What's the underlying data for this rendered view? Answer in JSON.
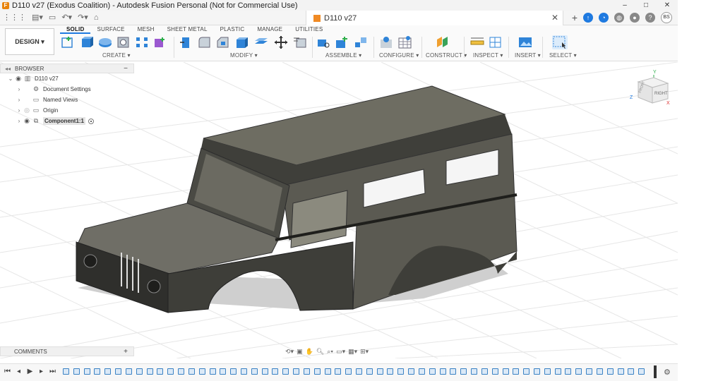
{
  "window": {
    "title": "D110 v27 (Exodus Coalition) - Autodesk Fusion Personal (Not for Commercial Use)",
    "controls": [
      "–",
      "□",
      "✕"
    ]
  },
  "tabbar": {
    "document_tab": "D110 v27",
    "user_initials": "BS"
  },
  "ribbon": {
    "workspace": "DESIGN",
    "tabs": [
      "SOLID",
      "SURFACE",
      "MESH",
      "SHEET METAL",
      "PLASTIC",
      "MANAGE",
      "UTILITIES"
    ],
    "active_tab": "SOLID",
    "groups": {
      "create": "CREATE",
      "modify": "MODIFY",
      "assemble": "ASSEMBLE",
      "configure": "CONFIGURE",
      "construct": "CONSTRUCT",
      "inspect": "INSPECT",
      "insert": "INSERT",
      "select": "SELECT"
    }
  },
  "browser": {
    "title": "BROWSER",
    "root": "D110 v27",
    "items": [
      {
        "label": "Document Settings"
      },
      {
        "label": "Named Views"
      },
      {
        "label": "Origin"
      },
      {
        "label": "Component1:1"
      }
    ]
  },
  "viewcube": {
    "face": "RIGHT",
    "top_face": "FRONT",
    "axis_y": "Y",
    "axis_z": "Z",
    "axis_x": "X"
  },
  "comments": {
    "title": "COMMENTS"
  },
  "colors": {
    "accent": "#1f7ae0",
    "body_dark": "#4a4a44",
    "body_roof": "#6b6a5e",
    "shadow": "#c9c9c9"
  },
  "timeline": {
    "feature_count": 56
  }
}
